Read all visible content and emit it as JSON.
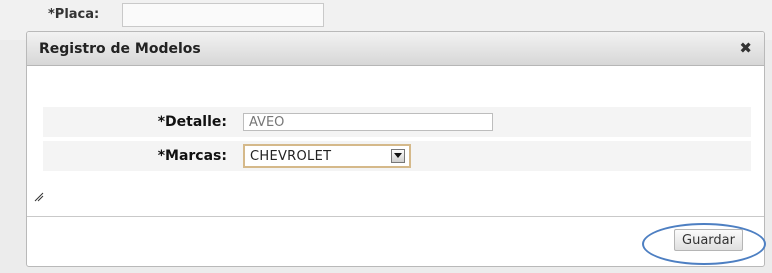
{
  "background": {
    "field_label": "*Placa:",
    "field_value": ""
  },
  "dialog": {
    "title": "Registro de Modelos",
    "close_icon": "close-icon",
    "fields": {
      "detalle": {
        "label": "*Detalle:",
        "value": "AVEO"
      },
      "marcas": {
        "label": "*Marcas:",
        "selected": "CHEVROLET"
      }
    },
    "guardar_label": "Guardar"
  },
  "annotation": {
    "color": "#4d7fc2"
  }
}
